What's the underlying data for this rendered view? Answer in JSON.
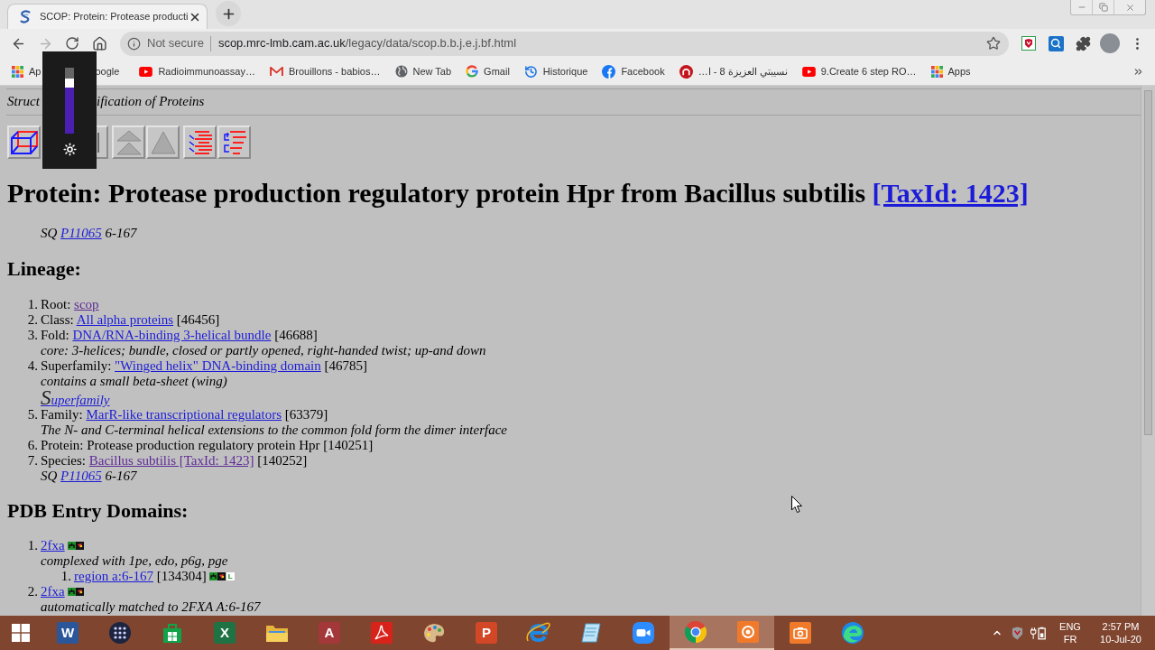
{
  "browser": {
    "tab": {
      "title": "SCOP: Protein: Protease producti",
      "selected": true
    },
    "nav": [
      {
        "kind": "back",
        "disabled": false
      },
      {
        "kind": "forward",
        "disabled": true
      },
      {
        "kind": "reload",
        "disabled": false
      },
      {
        "kind": "home",
        "disabled": false
      }
    ],
    "address_bar": {
      "security": "Not secure",
      "domain": "scop.mrc-lmb.cam.ac.uk",
      "path": "/legacy/data/scop.b.b.j.e.j.bf.html"
    },
    "extensions": [
      {
        "kind": "shield"
      },
      {
        "kind": "search"
      },
      {
        "kind": "puzzle"
      },
      {
        "kind": "avatar"
      },
      {
        "kind": "menu"
      }
    ],
    "bookmarks": [
      {
        "kind": "apps",
        "label": "Ap"
      },
      {
        "label": "oogle"
      },
      {
        "kind": "youtube",
        "label": "Radioimmunoassay…"
      },
      {
        "kind": "mail",
        "label": "Brouillons - babios…"
      },
      {
        "kind": "globe",
        "label": "New Tab"
      },
      {
        "kind": "google",
        "label": "Gmail"
      },
      {
        "kind": "history",
        "label": "Historique"
      },
      {
        "kind": "facebook",
        "label": "Facebook"
      },
      {
        "kind": "red-circle",
        "label": "نسيبتي العزيزة 8 - ا…"
      },
      {
        "kind": "youtube",
        "label": "9.Create 6 step RO…"
      },
      {
        "kind": "apps",
        "label": "Apps"
      }
    ]
  },
  "brightness_overlay": {
    "level": 0.7
  },
  "page": {
    "site_title_parts": [
      "Struct",
      "ification of Proteins"
    ],
    "toolbar": [
      {
        "kind": "cube",
        "disabled": false
      },
      {
        "kind": "edge",
        "disabled": false
      },
      {
        "kind": "up-double",
        "disabled": true
      },
      {
        "kind": "up",
        "disabled": true
      },
      {
        "kind": "sequence-list",
        "disabled": false
      },
      {
        "kind": "tree-list",
        "disabled": false
      }
    ],
    "heading": {
      "text": "Protein: Protease production regulatory protein Hpr from Bacillus subtilis",
      "link": {
        "text": "[TaxId: 1423]",
        "visited": false
      }
    },
    "sequence": {
      "prefix": "SQ",
      "link": "P11065",
      "range": "6-167"
    },
    "lineage_heading": "Lineage:",
    "lineage": [
      {
        "number": "1.",
        "label": "Root:",
        "link": "scop",
        "visited": true
      },
      {
        "number": "2.",
        "label": "Class:",
        "link": "All alpha proteins",
        "visited": false,
        "id": "[46456]"
      },
      {
        "number": "3.",
        "label": "Fold:",
        "link": "DNA/RNA-binding 3-helical bundle",
        "visited": false,
        "id": "[46688]",
        "note": "core: 3-helices; bundle, closed or partly opened, right-handed twist; up-and down"
      },
      {
        "number": "4.",
        "label": "Superfamily:",
        "link": "\"Winged helix\" DNA-binding domain",
        "visited": false,
        "id": "[46785]",
        "note": "contains a small beta-sheet (wing)",
        "extra_link": "Superfamily"
      },
      {
        "number": "5.",
        "label": "Family:",
        "link": "MarR-like transcriptional regulators",
        "visited": false,
        "id": "[63379]",
        "note": "The N- and C-terminal helical extensions to the common fold form the dimer interface"
      },
      {
        "number": "6.",
        "label": "Protein:",
        "text": "Protease production regulatory protein Hpr",
        "id": "[140251]"
      },
      {
        "number": "7.",
        "label": "Species:",
        "link": "Bacillus subtilis [TaxId: 1423]",
        "visited": true,
        "id": "[140252]",
        "sequence": {
          "prefix": "SQ",
          "link": "P11065",
          "range": "6-167"
        }
      }
    ],
    "pdb_heading": "PDB Entry Domains:",
    "pdb_entries": [
      {
        "number": "1.",
        "link": "2fxa",
        "visited": false,
        "note": "complexed with 1pe, edo, p6g, pge",
        "regions": [
          {
            "number": "1.",
            "link": "region a:6-167",
            "visited": false,
            "id": "[134304]",
            "badge": "L"
          }
        ]
      },
      {
        "number": "2.",
        "link": "2fxa",
        "visited": false,
        "note": "automatically matched to 2FXA A:6-167"
      }
    ]
  },
  "taskbar": {
    "apps": [
      {
        "kind": "start",
        "selected": false
      },
      {
        "kind": "word",
        "glyph": "W",
        "selected": false
      },
      {
        "kind": "launcher",
        "selected": false
      },
      {
        "kind": "store",
        "selected": false
      },
      {
        "kind": "excel",
        "glyph": "X",
        "selected": false
      },
      {
        "kind": "folder",
        "selected": false
      },
      {
        "kind": "access",
        "glyph": "A",
        "selected": false
      },
      {
        "kind": "acrobat",
        "selected": false
      },
      {
        "kind": "paint",
        "selected": false
      },
      {
        "kind": "powerpoint",
        "glyph": "P",
        "selected": false
      },
      {
        "kind": "ie",
        "selected": false
      },
      {
        "kind": "notepad",
        "selected": false
      },
      {
        "kind": "zoom",
        "selected": false
      },
      {
        "kind": "chrome",
        "selected": true
      },
      {
        "kind": "recorder",
        "selected": true
      },
      {
        "kind": "screenshot",
        "selected": false
      },
      {
        "kind": "edge",
        "selected": false
      }
    ],
    "tray": {
      "input_language": "ENG",
      "keyboard_layout": "FR",
      "time": "2:57 PM",
      "date": "10-Jul-20"
    }
  }
}
